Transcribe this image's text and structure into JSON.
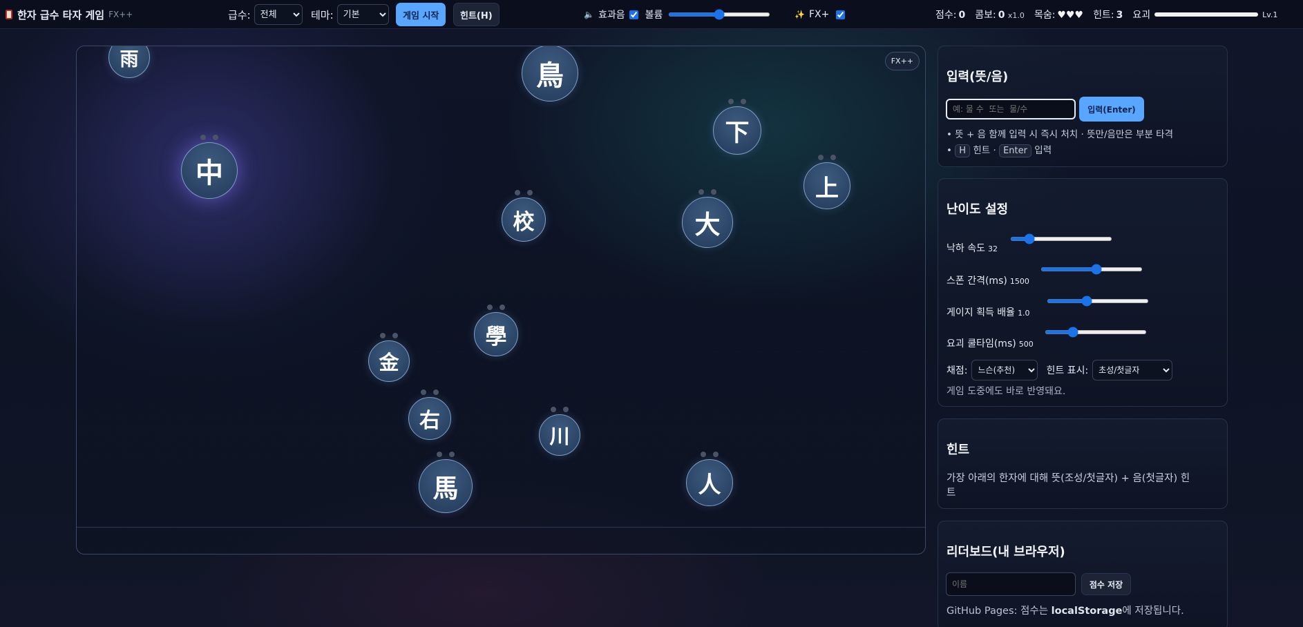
{
  "topbar": {
    "title": "한자 급수 타자 게임",
    "fx_tag": "FX++",
    "grade_label": "급수:",
    "grade_value": "전체",
    "theme_label": "테마:",
    "theme_value": "기본",
    "start_button": "게임 시작",
    "hint_button": "힌트(H)",
    "sound_icon": "🔈",
    "sfx_label": "효과음",
    "sfx_checked": true,
    "volume_label": "볼륨",
    "volume_level": 0.5,
    "fx_icon": "✨",
    "fx_label": "FX+",
    "fx_checked": true,
    "score_label": "점수:",
    "score_value": "0",
    "combo_label": "콤보:",
    "combo_value": "0",
    "combo_mult": "x1.0",
    "lives_label": "목숨:",
    "lives_value": "♥♥♥",
    "hints_label": "힌트:",
    "hints_value": "3",
    "ult_label": "요괴",
    "ult_level": "Lv.1"
  },
  "arena": {
    "fx_badge": "FX++",
    "chars": [
      "雨",
      "鳥",
      "下",
      "中",
      "上",
      "校",
      "大",
      "學",
      "金",
      "右",
      "川",
      "馬",
      "人"
    ]
  },
  "input_panel": {
    "title": "입력(뜻/음)",
    "placeholder": "예: 물 수  또는  물/수",
    "submit_button": "입력(Enter)",
    "help1": "• 뜻 + 음 함께 입력 시 즉시 처치 · 뜻만/음만은 부분 타격",
    "help2_prefix": "•",
    "key_h": "H",
    "help2_mid": "힌트 ·",
    "key_enter": "Enter",
    "help2_suffix": "입력"
  },
  "difficulty_panel": {
    "title": "난이도 설정",
    "fall_speed_label": "낙하 속도",
    "fall_speed_value": "32",
    "fall_speed_level": 0.15,
    "spawn_label": "스폰 간격(ms)",
    "spawn_value": "1500",
    "spawn_level": 0.55,
    "gauge_label": "게이지 획득 배율",
    "gauge_value": "1.0",
    "gauge_level": 0.38,
    "cooldown_label": "요괴 쿨타임(ms)",
    "cooldown_value": "500",
    "cooldown_level": 0.25,
    "grading_label": "채점:",
    "grading_value": "느슨(추천)",
    "hint_display_label": "힌트 표시:",
    "hint_display_value": "초성/첫글자",
    "note": "게임 도중에도 바로 반영돼요."
  },
  "hint_panel": {
    "title": "힌트",
    "text_line1": "가장 아래의 한자에 대해 뜻(조성/첫글자) + 음(첫글자) 힌",
    "text_line2": "트"
  },
  "leaderboard_panel": {
    "title": "리더보드(내 브라우저)",
    "name_placeholder": "이름",
    "save_button": "점수 저장",
    "note_prefix": "GitHub Pages: 점수는",
    "note_bold": "localStorage",
    "note_suffix": "에 저장됩니다."
  }
}
